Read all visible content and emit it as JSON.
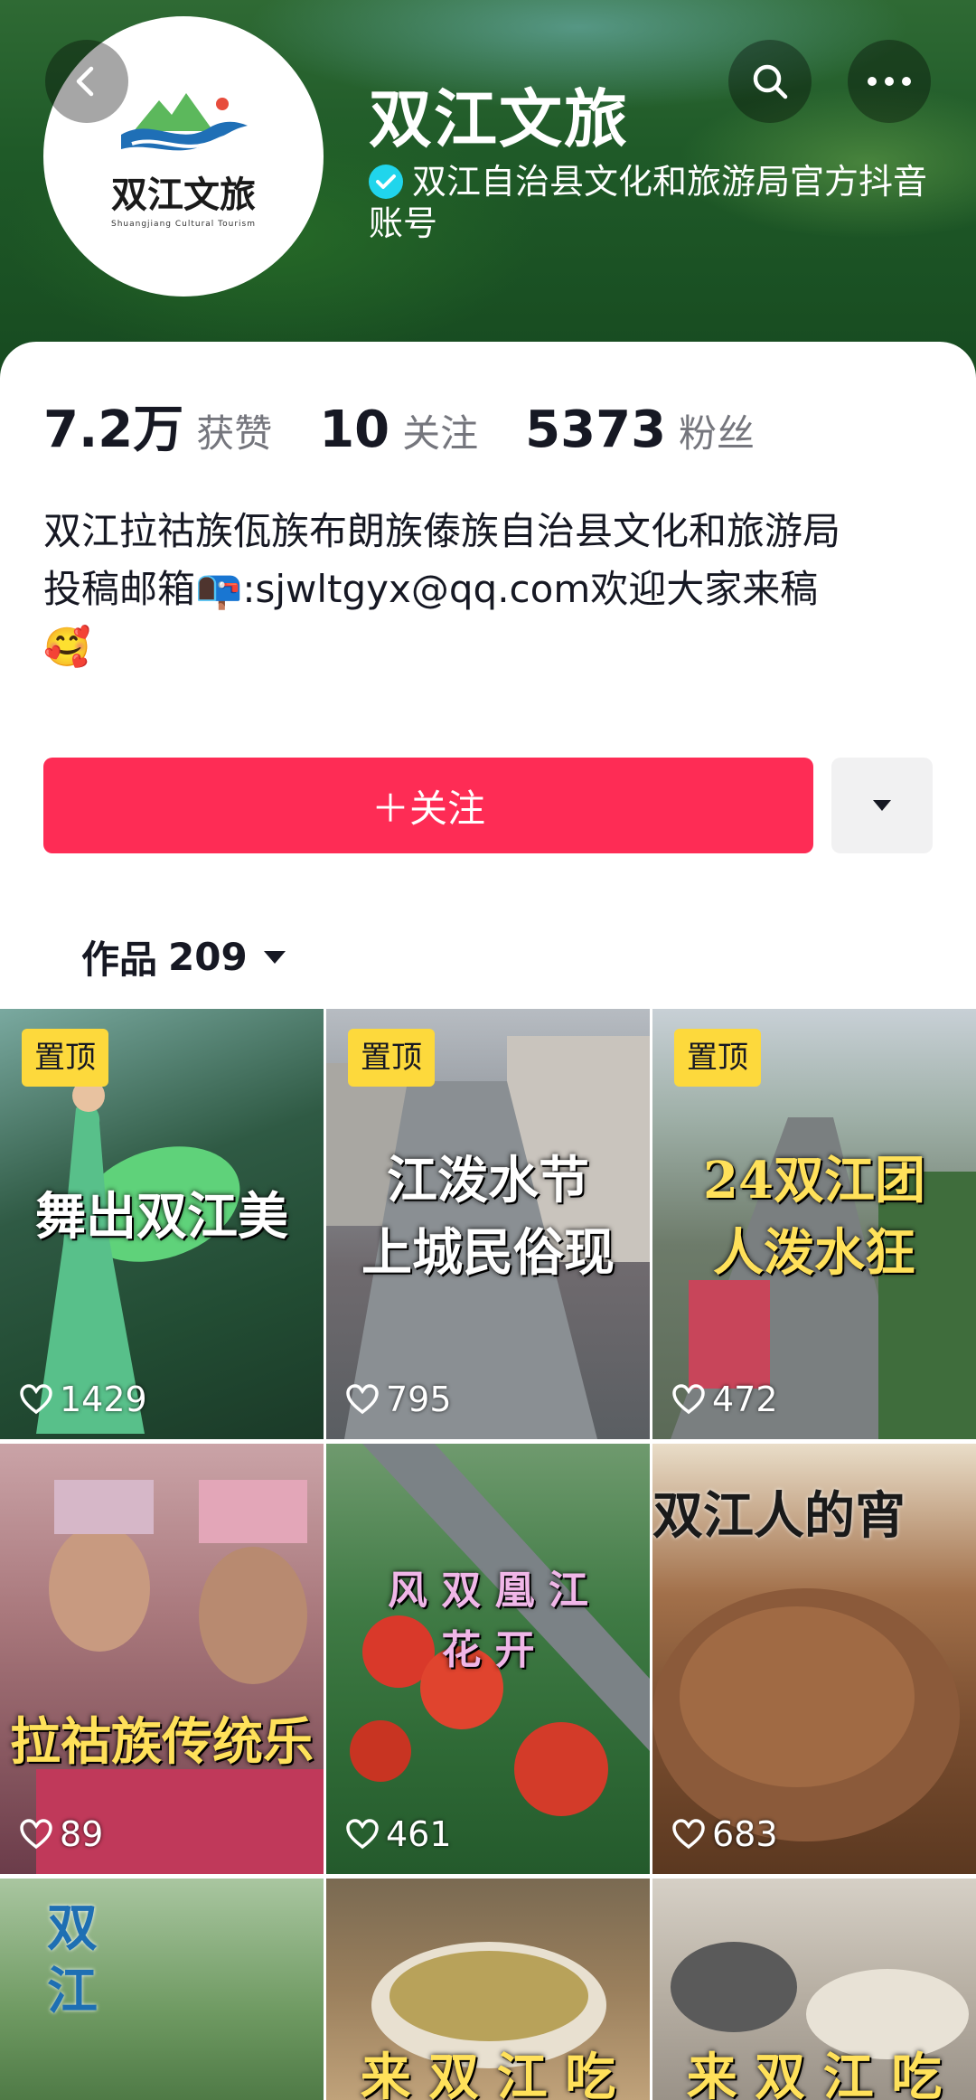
{
  "header": {
    "account_name": "双江文旅",
    "verified_text": "双江自治县文化和旅游局官方抖音账号",
    "avatar_logo_text": "双江文旅",
    "avatar_logo_sub": "Shuangjiang Cultural Tourism"
  },
  "stats": [
    {
      "value": "7.2万",
      "label": "获赞"
    },
    {
      "value": "10",
      "label": "关注"
    },
    {
      "value": "5373",
      "label": "粉丝"
    }
  ],
  "bio": {
    "line1": "双江拉祜族佤族布朗族傣族自治县文化和旅游局",
    "line2_prefix": "投稿邮箱",
    "line2_emoji": "📭",
    "line2_suffix": ":sjwltgyx@qq.com欢迎大家来稿",
    "line3_emoji": "🥰"
  },
  "actions": {
    "follow_label": "＋关注"
  },
  "works_tab": {
    "label": "作品",
    "count": "209"
  },
  "videos": [
    {
      "pinned": true,
      "pin_label": "置顶",
      "title": "舞出双江美",
      "likes": "1429"
    },
    {
      "pinned": true,
      "pin_label": "置顶",
      "title": "江泼水节\n上城民俗现",
      "likes": "795"
    },
    {
      "pinned": true,
      "pin_label": "置顶",
      "title": "24双江团\n人泼水狂",
      "likes": "472"
    },
    {
      "pinned": false,
      "title": "拉祜族传统乐",
      "likes": "89"
    },
    {
      "pinned": false,
      "title": "风 双 凰 江 花 开",
      "likes": "461"
    },
    {
      "pinned": false,
      "title": "双江人的宵",
      "likes": "683"
    },
    {
      "pinned": false,
      "title": "双 江",
      "likes": ""
    },
    {
      "pinned": false,
      "title": "来 双 江 吃",
      "likes": ""
    },
    {
      "pinned": false,
      "title": "来 双 江 吃",
      "likes": ""
    }
  ],
  "colors": {
    "accent": "#fe2c55",
    "pin_badge": "#fdd93c",
    "verified": "#20d5ec"
  }
}
